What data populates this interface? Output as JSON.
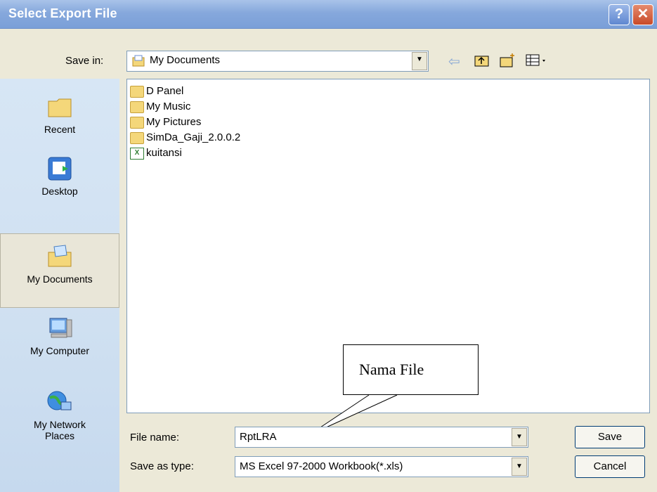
{
  "window": {
    "title": "Select Export File",
    "help_glyph": "?",
    "close_glyph": "✕"
  },
  "save_in": {
    "label": "Save in:",
    "value": "My Documents"
  },
  "toolbar": {
    "icons": [
      "back-icon",
      "up-folder-icon",
      "new-folder-icon",
      "view-menu-icon"
    ]
  },
  "places": [
    {
      "label": "Recent",
      "icon": "recent-folder-icon"
    },
    {
      "label": "Desktop",
      "icon": "desktop-icon"
    },
    {
      "label": "My Documents",
      "icon": "my-documents-icon"
    },
    {
      "label": "My Computer",
      "icon": "my-computer-icon"
    },
    {
      "label": "My Network Places",
      "icon": "network-places-icon"
    }
  ],
  "files": [
    {
      "name": "D Panel",
      "type": "folder"
    },
    {
      "name": "My Music",
      "type": "folder"
    },
    {
      "name": "My Pictures",
      "type": "folder"
    },
    {
      "name": "SimDa_Gaji_2.0.0.2",
      "type": "folder"
    },
    {
      "name": "kuitansi",
      "type": "excel"
    }
  ],
  "file_name": {
    "label": "File name:",
    "value": "RptLRA"
  },
  "save_as_type": {
    "label": "Save as type:",
    "value": "MS Excel 97-2000 Workbook(*.xls)"
  },
  "buttons": {
    "save": "Save",
    "cancel": "Cancel"
  },
  "annotation": {
    "text": "Nama File"
  }
}
